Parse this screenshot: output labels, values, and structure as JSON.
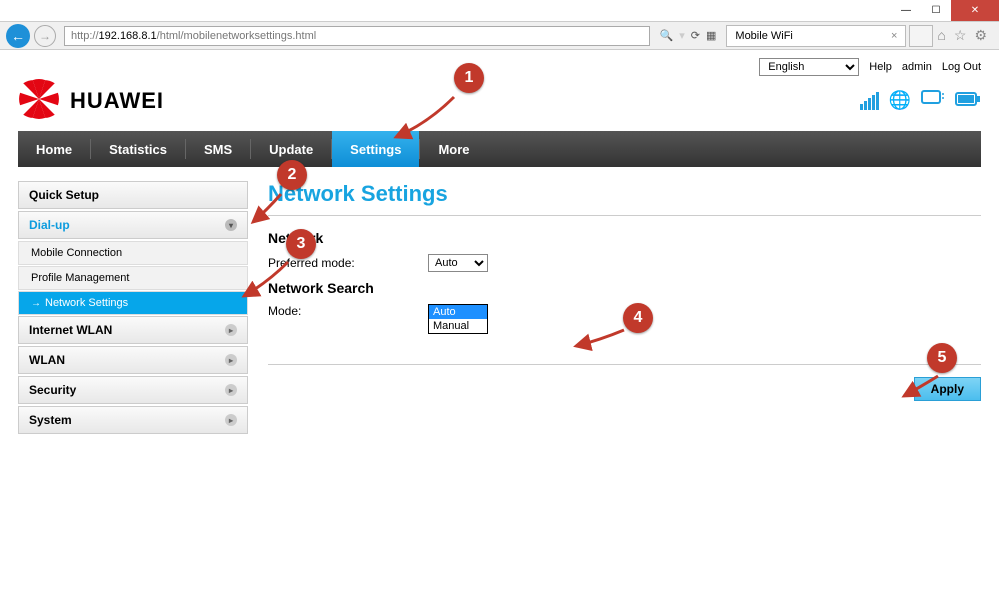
{
  "browser": {
    "url_prefix": "http://",
    "url_host": "192.168.8.1",
    "url_path": "/html/mobilenetworksettings.html",
    "tab_title": "Mobile WiFi"
  },
  "topbar": {
    "language": "English",
    "help": "Help",
    "user": "admin",
    "logout": "Log Out"
  },
  "brand": {
    "name": "HUAWEI"
  },
  "nav": {
    "items": [
      "Home",
      "Statistics",
      "SMS",
      "Update",
      "Settings",
      "More"
    ],
    "active_index": 4
  },
  "sidebar": {
    "sections": [
      {
        "label": "Quick Setup",
        "expanded": false
      },
      {
        "label": "Dial-up",
        "expanded": true,
        "items": [
          "Mobile Connection",
          "Profile Management",
          "Network Settings"
        ],
        "active_item": 2
      },
      {
        "label": "Internet WLAN",
        "expanded": false
      },
      {
        "label": "WLAN",
        "expanded": false
      },
      {
        "label": "Security",
        "expanded": false
      },
      {
        "label": "System",
        "expanded": false
      }
    ]
  },
  "page": {
    "title": "Network Settings",
    "section_network": "Network",
    "preferred_mode_label": "Preferred mode:",
    "preferred_mode_value": "Auto",
    "section_search": "Network Search",
    "mode_label": "Mode:",
    "mode_options": [
      "Auto",
      "Manual"
    ],
    "mode_selected": "Auto",
    "apply": "Apply"
  },
  "callouts": {
    "c1": "1",
    "c2": "2",
    "c3": "3",
    "c4": "4",
    "c5": "5"
  }
}
